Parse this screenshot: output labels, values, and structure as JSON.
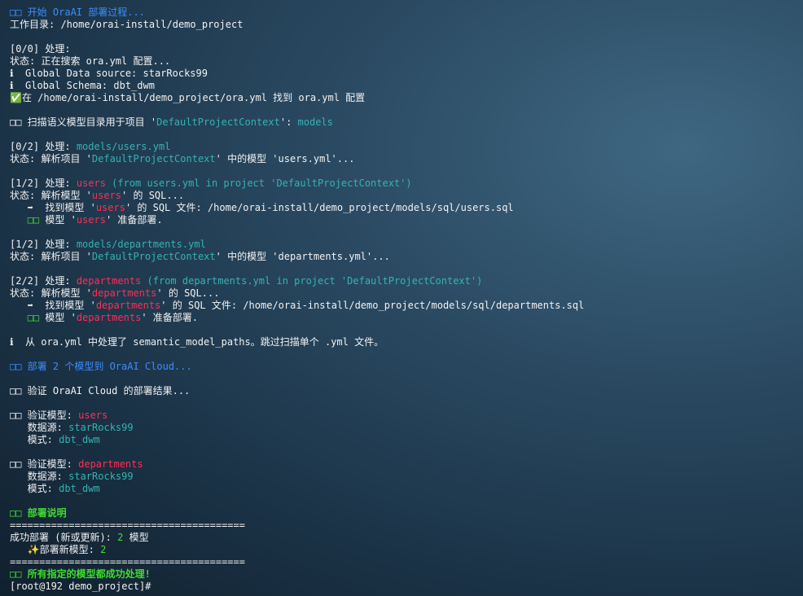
{
  "lines": [
    [
      {
        "t": "□□ 开始 OraAI 部署过程...",
        "c": "b"
      }
    ],
    [
      {
        "t": "工作目录: /home/orai-install/demo_project",
        "c": "w"
      }
    ],
    [],
    [
      {
        "t": "[0/0] 处理:",
        "c": "w"
      }
    ],
    [
      {
        "t": "状态: 正在搜索 ora.yml 配置...",
        "c": "w"
      }
    ],
    [
      {
        "t": "ℹ  Global Data source: starRocks99",
        "c": "w"
      }
    ],
    [
      {
        "t": "ℹ  Global Schema: dbt_dwm",
        "c": "w"
      }
    ],
    [
      {
        "t": "✅在 /home/orai-install/demo_project/ora.yml 找到 ora.yml 配置",
        "c": "w"
      }
    ],
    [],
    [
      {
        "t": "□□ 扫描语义模型目录用于项目 '",
        "c": "w"
      },
      {
        "t": "DefaultProjectContext",
        "c": "c"
      },
      {
        "t": "': ",
        "c": "w"
      },
      {
        "t": "models",
        "c": "c"
      }
    ],
    [],
    [
      {
        "t": "[0/2] 处理: ",
        "c": "w"
      },
      {
        "t": "models/users.yml",
        "c": "c"
      }
    ],
    [
      {
        "t": "状态: 解析项目 '",
        "c": "w"
      },
      {
        "t": "DefaultProjectContext",
        "c": "c"
      },
      {
        "t": "' 中的模型 'users.yml'...",
        "c": "w"
      }
    ],
    [],
    [
      {
        "t": "[1/2] 处理: ",
        "c": "w"
      },
      {
        "t": "users",
        "c": "r"
      },
      {
        "t": " (from users.yml in project 'DefaultProjectContext')",
        "c": "c"
      }
    ],
    [
      {
        "t": "状态: 解析模型 '",
        "c": "w"
      },
      {
        "t": "users",
        "c": "r"
      },
      {
        "t": "' 的 SQL...",
        "c": "w"
      }
    ],
    [
      {
        "t": "   ➡  找到模型 '",
        "c": "w"
      },
      {
        "t": "users",
        "c": "r"
      },
      {
        "t": "' 的 SQL 文件: /home/orai-install/demo_project/models/sql/users.sql",
        "c": "w"
      }
    ],
    [
      {
        "t": "   ",
        "c": "w"
      },
      {
        "t": "□□",
        "c": "gn"
      },
      {
        "t": " 模型 '",
        "c": "w"
      },
      {
        "t": "users",
        "c": "r"
      },
      {
        "t": "' 准备部署.",
        "c": "w"
      }
    ],
    [],
    [
      {
        "t": "[1/2] 处理: ",
        "c": "w"
      },
      {
        "t": "models/departments.yml",
        "c": "c"
      }
    ],
    [
      {
        "t": "状态: 解析项目 '",
        "c": "w"
      },
      {
        "t": "DefaultProjectContext",
        "c": "c"
      },
      {
        "t": "' 中的模型 'departments.yml'...",
        "c": "w"
      }
    ],
    [],
    [
      {
        "t": "[2/2] 处理: ",
        "c": "w"
      },
      {
        "t": "departments",
        "c": "r"
      },
      {
        "t": " (from departments.yml in project 'DefaultProjectContext')",
        "c": "c"
      }
    ],
    [
      {
        "t": "状态: 解析模型 '",
        "c": "w"
      },
      {
        "t": "departments",
        "c": "r"
      },
      {
        "t": "' 的 SQL...",
        "c": "w"
      }
    ],
    [
      {
        "t": "   ➡  找到模型 '",
        "c": "w"
      },
      {
        "t": "departments",
        "c": "r"
      },
      {
        "t": "' 的 SQL 文件: /home/orai-install/demo_project/models/sql/departments.sql",
        "c": "w"
      }
    ],
    [
      {
        "t": "   ",
        "c": "w"
      },
      {
        "t": "□□",
        "c": "gn"
      },
      {
        "t": " 模型 '",
        "c": "w"
      },
      {
        "t": "departments",
        "c": "r"
      },
      {
        "t": "' 准备部署.",
        "c": "w"
      }
    ],
    [],
    [
      {
        "t": "ℹ  从 ora.yml 中处理了 semantic_model_paths。跳过扫描单个 .yml 文件。",
        "c": "w"
      }
    ],
    [],
    [
      {
        "t": "□□ 部署 2 个模型到 OraAI Cloud...",
        "c": "b"
      }
    ],
    [],
    [
      {
        "t": "□□ 验证 OraAI Cloud 的部署结果...",
        "c": "w"
      }
    ],
    [],
    [
      {
        "t": "□□ 验证模型: ",
        "c": "w"
      },
      {
        "t": "users",
        "c": "r"
      }
    ],
    [
      {
        "t": "   数据源: ",
        "c": "w"
      },
      {
        "t": "starRocks99",
        "c": "c"
      }
    ],
    [
      {
        "t": "   模式: ",
        "c": "w"
      },
      {
        "t": "dbt_dwm",
        "c": "c"
      }
    ],
    [],
    [
      {
        "t": "□□ 验证模型: ",
        "c": "w"
      },
      {
        "t": "departments",
        "c": "r"
      }
    ],
    [
      {
        "t": "   数据源: ",
        "c": "w"
      },
      {
        "t": "starRocks99",
        "c": "c"
      }
    ],
    [
      {
        "t": "   模式: ",
        "c": "w"
      },
      {
        "t": "dbt_dwm",
        "c": "c"
      }
    ],
    [],
    [
      {
        "t": "□□ 部署说明",
        "c": "g"
      }
    ],
    [
      {
        "t": "========================================",
        "c": "w"
      }
    ],
    [
      {
        "t": "成功部署 (新或更新): ",
        "c": "w"
      },
      {
        "t": "2",
        "c": "gn"
      },
      {
        "t": " 模型",
        "c": "w"
      }
    ],
    [
      {
        "t": "   ✨部署新模型: ",
        "c": "w"
      },
      {
        "t": "2",
        "c": "gn"
      }
    ],
    [
      {
        "t": "========================================",
        "c": "w"
      }
    ],
    [
      {
        "t": "□□ 所有指定的模型都成功处理!",
        "c": "g"
      }
    ],
    [
      {
        "t": "[root@192 demo_project]# ",
        "c": "w"
      }
    ]
  ],
  "colors": {
    "white": "#f2f2f2",
    "blue": "#3d8dff",
    "cyan": "#34b3b3",
    "red": "#ff2e56",
    "green": "#3fdc2f"
  }
}
